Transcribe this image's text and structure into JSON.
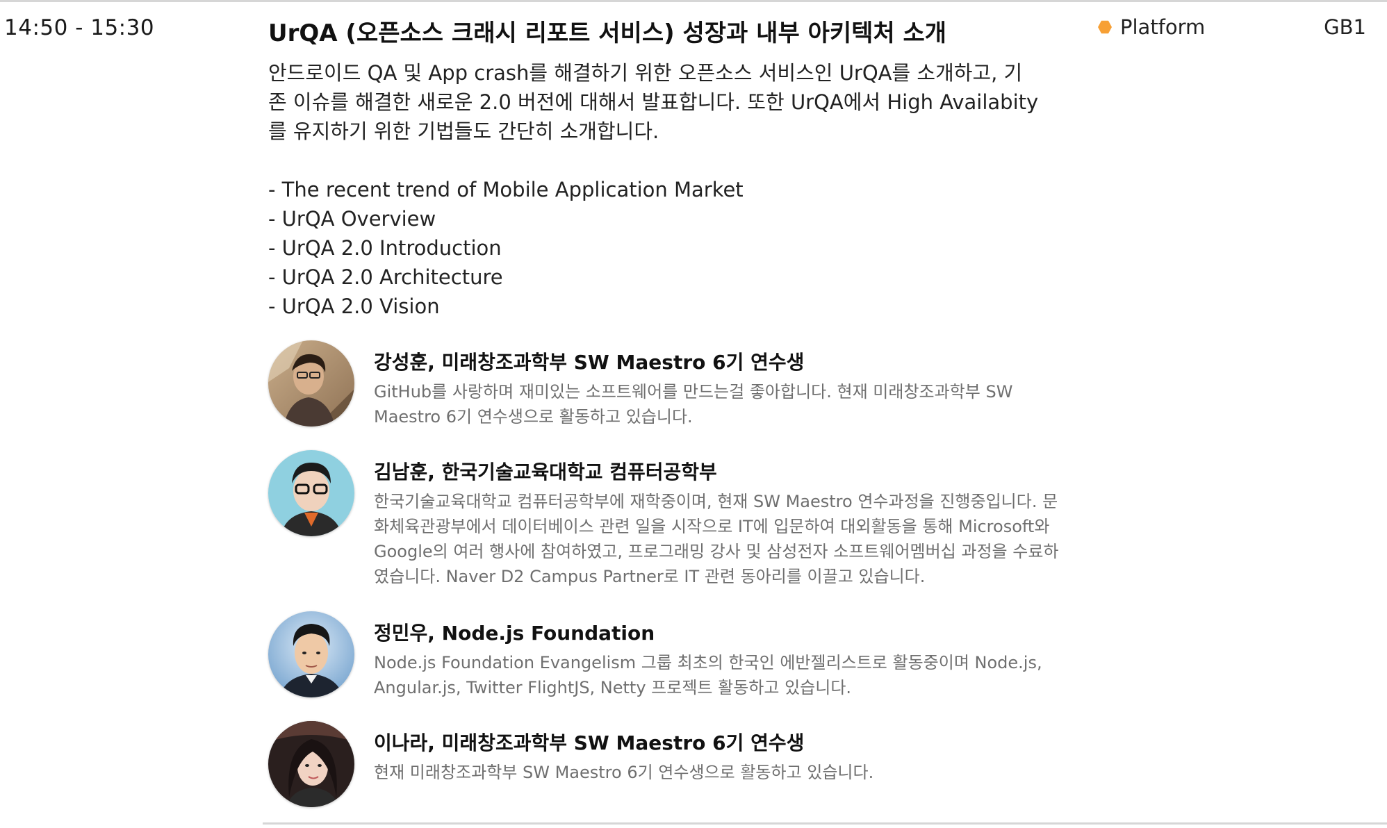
{
  "session": {
    "time": "14:50 - 15:30",
    "title": "UrQA (오픈소스 크래시 리포트 서비스) 성장과 내부 아키텍처 소개",
    "track": "Platform",
    "track_color": "#f7a035",
    "room": "GB1"
  },
  "description": {
    "intro_lines": [
      "안드로이드 QA 및 App crash를  해결하기 위한 오픈소스 서비스인  UrQA를  소개하고, 기",
      "존 이슈를 해결한  새로운 2.0 버전에 대해서 발표합니다. 또한 UrQA에서 High Availabity",
      "를 유지하기 위한 기법들도 간단히 소개합니다."
    ],
    "agenda": [
      "- The recent trend of Mobile Application Market",
      "- UrQA Overview",
      "- UrQA 2.0 Introduction",
      "- UrQA 2.0 Architecture",
      "- UrQA 2.0 Vision"
    ]
  },
  "speakers": [
    {
      "name": "강성훈, 미래창조과학부 SW Maestro 6기 연수생",
      "bio_lines": [
        "GitHub를 사랑하며 재미있는 소프트웨어를 만드는걸 좋아합니다. 현재 미래창조과학부 SW",
        "Maestro 6기 연수생으로 활동하고 있습니다."
      ],
      "avatar_icon": "person-photo-icon"
    },
    {
      "name": "김남훈, 한국기술교육대학교 컴퓨터공학부",
      "bio_lines": [
        "한국기술교육대학교 컴퓨터공학부에 재학중이며, 현재 SW Maestro 연수과정을 진행중입니다. 문",
        "화체육관광부에서 데이터베이스 관련 일을 시작으로 IT에 입문하여 대외활동을 통해 Microsoft와",
        "Google의 여러 행사에 참여하였고, 프로그래밍 강사 및 삼성전자 소프트웨어멤버십 과정을 수료하",
        "였습니다. Naver D2 Campus Partner로 IT 관련 동아리를 이끌고 있습니다."
      ],
      "avatar_icon": "person-photo-icon"
    },
    {
      "name": "정민우, Node.js Foundation",
      "bio_lines": [
        "Node.js  Foundation Evangelism 그룹 최초의 한국인 에반젤리스트로 활동중이며 Node.js,",
        "Angular.js, Twitter FlightJS, Netty 프로젝트 활동하고 있습니다."
      ],
      "avatar_icon": "person-photo-icon"
    },
    {
      "name": "이나라, 미래창조과학부 SW Maestro 6기 연수생",
      "bio_lines": [
        "현재 미래창조과학부 SW Maestro 6기 연수생으로 활동하고 있습니다."
      ],
      "avatar_icon": "person-photo-icon"
    }
  ]
}
